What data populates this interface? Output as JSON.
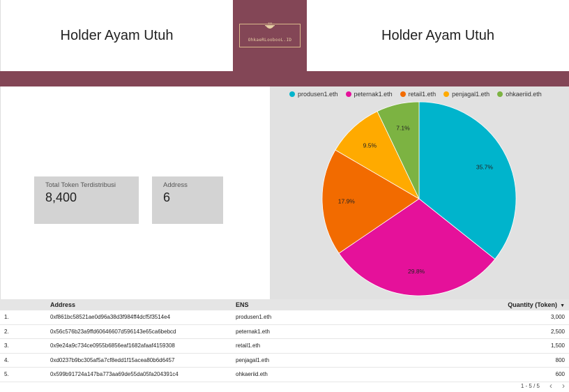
{
  "header": {
    "left_title": "Holder Ayam Utuh",
    "right_title": "Holder Ayam Utuh",
    "logo_text": "OhkaeRLoobooL.ID"
  },
  "colors": {
    "brand": "#834656",
    "produsen": "#00b4cc",
    "peternak": "#e5119a",
    "retail": "#f26b00",
    "penjagal": "#ffaa00",
    "ohkaeriid": "#7cb342"
  },
  "scorecards": [
    {
      "label": "Total Token Terdistribusi",
      "value": "8,400"
    },
    {
      "label": "Address",
      "value": "6"
    }
  ],
  "chart_data": {
    "type": "pie",
    "legend_position": "top",
    "slices": [
      {
        "label": "produsen1.eth",
        "value": 35.7,
        "display": "35.7%",
        "color": "#00b4cc"
      },
      {
        "label": "peternak1.eth",
        "value": 29.8,
        "display": "29.8%",
        "color": "#e5119a"
      },
      {
        "label": "retail1.eth",
        "value": 17.9,
        "display": "17.9%",
        "color": "#f26b00"
      },
      {
        "label": "penjagal1.eth",
        "value": 9.5,
        "display": "9.5%",
        "color": "#ffaa00"
      },
      {
        "label": "ohkaeriid.eth",
        "value": 7.1,
        "display": "7.1%",
        "color": "#7cb342"
      }
    ]
  },
  "table": {
    "columns": {
      "address": "Address",
      "ens": "ENS",
      "quantity": "Quantity (Token)"
    },
    "sort_icon": "sort-down-icon",
    "rows": [
      {
        "idx": "1.",
        "address": "0xf861bc58521ae0d96a38d3f984ff4dcf5f3514e4",
        "ens": "produsen1.eth",
        "quantity": "3,000"
      },
      {
        "idx": "2.",
        "address": "0x56c576b23a9ffd60646607d596143e65ca6bebcd",
        "ens": "peternak1.eth",
        "quantity": "2,500"
      },
      {
        "idx": "3.",
        "address": "0x9e24a9c734ce0955b6856eaf1682afaaf4159308",
        "ens": "retail1.eth",
        "quantity": "1,500"
      },
      {
        "idx": "4.",
        "address": "0xd0237b9bc305af5a7cf8edd1f15acea80b6d6457",
        "ens": "penjagal1.eth",
        "quantity": "800"
      },
      {
        "idx": "5.",
        "address": "0x599b91724a147ba773aa69de55da05fa204391c4",
        "ens": "ohkaeriid.eth",
        "quantity": "600"
      }
    ],
    "pagination": "1 - 5 / 5"
  }
}
